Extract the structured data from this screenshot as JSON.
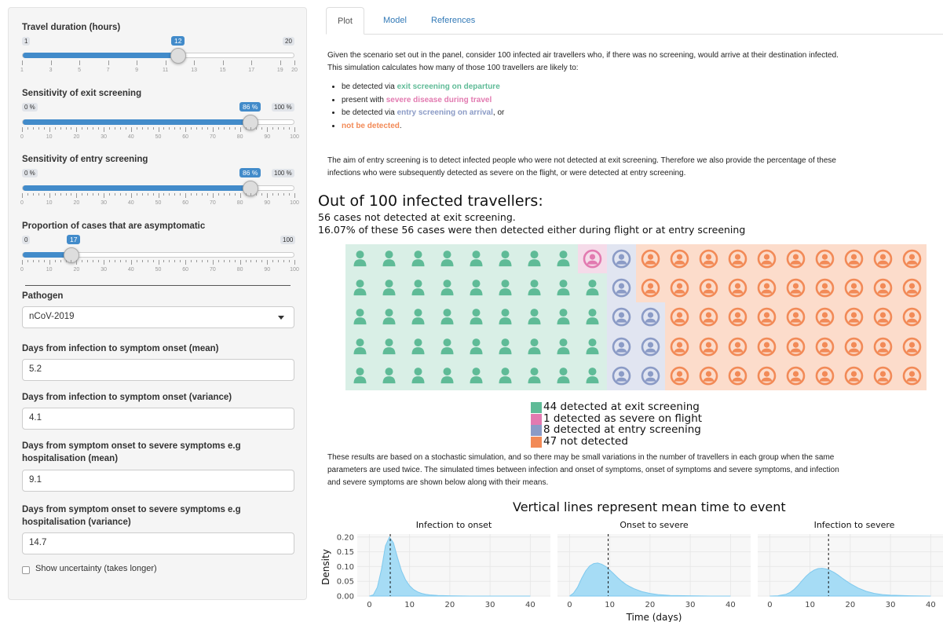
{
  "sidebar": {
    "travel": {
      "label": "Travel duration (hours)",
      "min": "1",
      "max": "20",
      "value": "12",
      "ticks": [
        "1",
        "3",
        "5",
        "7",
        "9",
        "11",
        "13",
        "15",
        "17",
        "19",
        "20"
      ]
    },
    "exit": {
      "label": "Sensitivity of exit screening",
      "min": "0 %",
      "max": "100 %",
      "value": "86 %",
      "ticks": [
        "0",
        "10",
        "20",
        "30",
        "40",
        "50",
        "60",
        "70",
        "80",
        "90",
        "100"
      ]
    },
    "entry": {
      "label": "Sensitivity of entry screening",
      "min": "0 %",
      "max": "100 %",
      "value": "86 %",
      "ticks": [
        "0",
        "10",
        "20",
        "30",
        "40",
        "50",
        "60",
        "70",
        "80",
        "90",
        "100"
      ]
    },
    "asym": {
      "label": "Proportion of cases that are asymptomatic",
      "min": "0",
      "max": "100",
      "value": "17",
      "ticks": [
        "0",
        "10",
        "20",
        "30",
        "40",
        "50",
        "60",
        "70",
        "80",
        "90",
        "100"
      ]
    },
    "pathogen": {
      "label": "Pathogen",
      "value": "nCoV-2019"
    },
    "onset_mean": {
      "label": "Days from infection to symptom onset (mean)",
      "value": "5.2"
    },
    "onset_var": {
      "label": "Days from infection to symptom onset (variance)",
      "value": "4.1"
    },
    "severe_mean": {
      "label1": "Days from symptom onset to severe symptoms e.g",
      "label2": "hospitalisation (mean)",
      "value": "9.1"
    },
    "severe_var": {
      "label1": "Days from symptom onset to severe symptoms e.g",
      "label2": "hospitalisation (variance)",
      "value": "14.7"
    },
    "uncertainty": {
      "label": "Show uncertainty (takes longer)",
      "checked": false
    }
  },
  "tabs": [
    "Plot",
    "Model",
    "References"
  ],
  "intro": {
    "p1a": "Given the scenario set out in the panel, consider 100 infected air travellers who, if there was no screening, would arrive at their destination infected.",
    "p1b": "This simulation calculates how many of those 100 travellers are likely to:",
    "b1_pre": "be detected via ",
    "b1_em": "exit screening on departure",
    "b2_pre": "present with ",
    "b2_em": "severe disease during travel",
    "b3_pre": "be detected via ",
    "b3_em": "entry screening on arrival",
    "b3_post": ", or",
    "b4_em": "not be detected",
    "b4_post": ".",
    "p2a": "The aim of entry screening is to detect infected people who were not detected at exit screening. Therefore we also provide the percentage of these",
    "p2b": "infections who were subsequently detected as severe on the flight, or were detected at entry screening."
  },
  "result": {
    "title": "Out of 100 infected travellers:",
    "line1": "56 cases not detected at exit screening.",
    "line2": "16.07% of these 56 cases were then detected either during flight or at entry screening"
  },
  "waffle": {
    "counts": {
      "exit": 44,
      "severe": 1,
      "entry": 8,
      "not": 47
    },
    "colors": {
      "exit": "#5fbb97",
      "severe": "#e27ab0",
      "entry": "#8b9bc6",
      "not": "#f28a57"
    },
    "bg": {
      "exit": "#d9efe6",
      "severe": "#f5dbe9",
      "entry": "#e1e5f1",
      "not": "#fcdccb"
    },
    "icons": {
      "exit": "person-icon",
      "severe": "person-circle-icon",
      "entry": "person-circle-icon",
      "not": "person-circle-icon"
    },
    "legend": [
      "44 detected at exit screening",
      "1 detected as severe on flight",
      "8 detected at entry screening",
      "47 not detected"
    ]
  },
  "outro": {
    "l1": "These results are based on a stochastic simulation, and so there may be small variations in the number of travellers in each group when the same",
    "l2": "parameters are used twice. The simulated times between infection and onset of symptoms, onset of symptoms and severe symptoms, and infection",
    "l3": "and severe symptoms are shown below along with their means."
  },
  "chart_data": {
    "type": "area",
    "title": "Vertical lines represent mean time to event",
    "xlabel": "Time (days)",
    "ylabel": "Density",
    "xlim": [
      -3,
      45
    ],
    "ylim": [
      0,
      0.21
    ],
    "yticks": [
      "0.00",
      "0.05",
      "0.10",
      "0.15",
      "0.20"
    ],
    "xticks": [
      "0",
      "10",
      "20",
      "30",
      "40"
    ],
    "fill": "#a6dcf5",
    "stroke": "#7fc9ee",
    "panels": [
      {
        "title": "Infection to onset",
        "mean": 5.2,
        "x": [
          0,
          1,
          2,
          3,
          4,
          5,
          6,
          7,
          8,
          9,
          10,
          11,
          12,
          13,
          14,
          15,
          17,
          20,
          25,
          30,
          40
        ],
        "y": [
          0,
          0.004,
          0.03,
          0.09,
          0.17,
          0.2,
          0.18,
          0.13,
          0.085,
          0.055,
          0.035,
          0.022,
          0.014,
          0.009,
          0.006,
          0.004,
          0.002,
          0.001,
          0,
          0,
          0
        ]
      },
      {
        "title": "Onset to severe",
        "mean": 9.6,
        "x": [
          0,
          1,
          2,
          3,
          4,
          5,
          6,
          7,
          8,
          9,
          10,
          11,
          12,
          13,
          14,
          15,
          16,
          18,
          20,
          22,
          25,
          30,
          35,
          40
        ],
        "y": [
          0,
          0.01,
          0.03,
          0.06,
          0.085,
          0.102,
          0.11,
          0.112,
          0.108,
          0.1,
          0.088,
          0.075,
          0.062,
          0.05,
          0.04,
          0.032,
          0.025,
          0.015,
          0.009,
          0.005,
          0.002,
          0.001,
          0,
          0
        ]
      },
      {
        "title": "Infection to severe",
        "mean": 14.6,
        "x": [
          0,
          2,
          4,
          5,
          6,
          7,
          8,
          9,
          10,
          11,
          12,
          13,
          14,
          15,
          16,
          17,
          18,
          19,
          20,
          22,
          24,
          26,
          28,
          30,
          35,
          40
        ],
        "y": [
          0,
          0.001,
          0.006,
          0.012,
          0.022,
          0.036,
          0.052,
          0.067,
          0.079,
          0.088,
          0.093,
          0.094,
          0.092,
          0.087,
          0.08,
          0.071,
          0.061,
          0.051,
          0.042,
          0.027,
          0.016,
          0.009,
          0.005,
          0.003,
          0.001,
          0
        ]
      }
    ]
  }
}
